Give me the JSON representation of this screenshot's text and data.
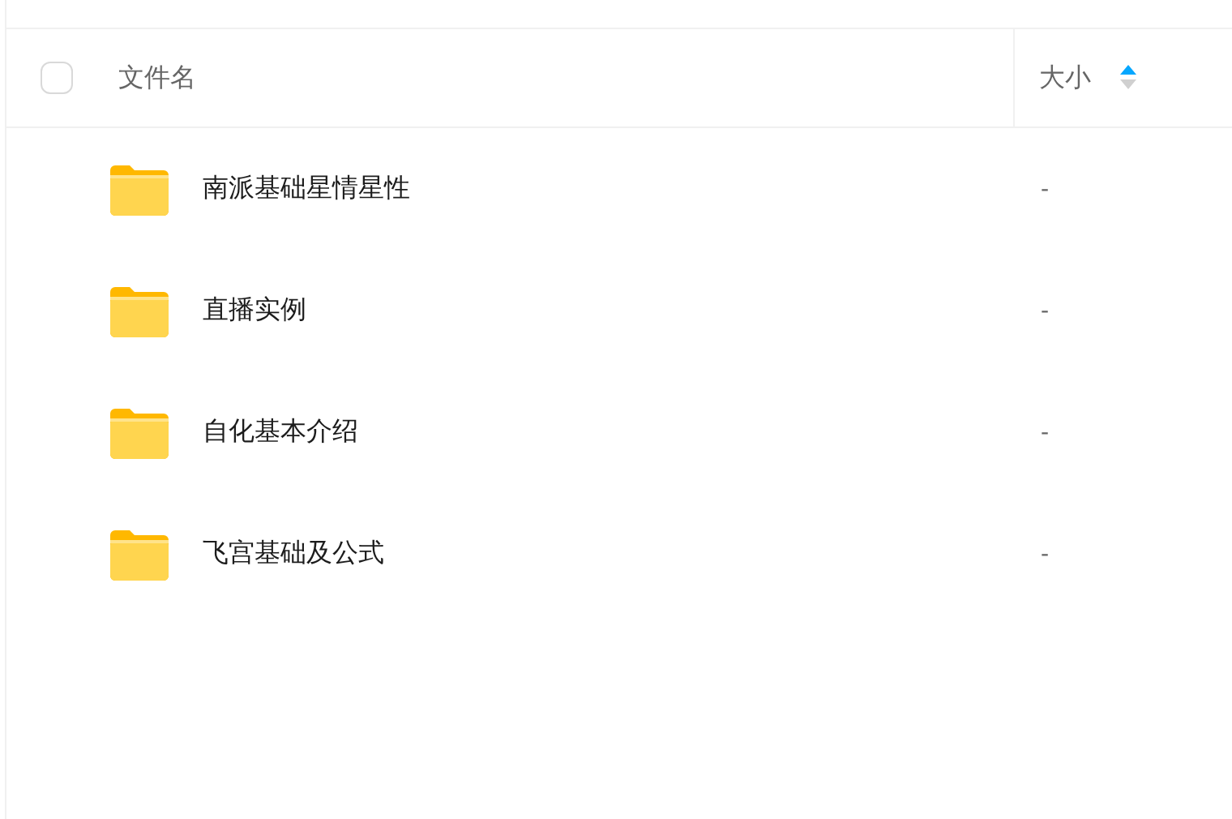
{
  "table": {
    "header_checkbox": {
      "checked": false
    },
    "columns": [
      {
        "label": "文件名"
      },
      {
        "label": "大小",
        "sorted": true
      }
    ],
    "rows": [
      {
        "kind": "folder",
        "name": "南派基础星情星性",
        "size": "-"
      },
      {
        "kind": "folder",
        "name": "直播实例",
        "size": "-"
      },
      {
        "kind": "folder",
        "name": "自化基本介绍",
        "size": "-"
      },
      {
        "kind": "folder",
        "name": "飞宫基础及公式",
        "size": "-"
      }
    ]
  }
}
